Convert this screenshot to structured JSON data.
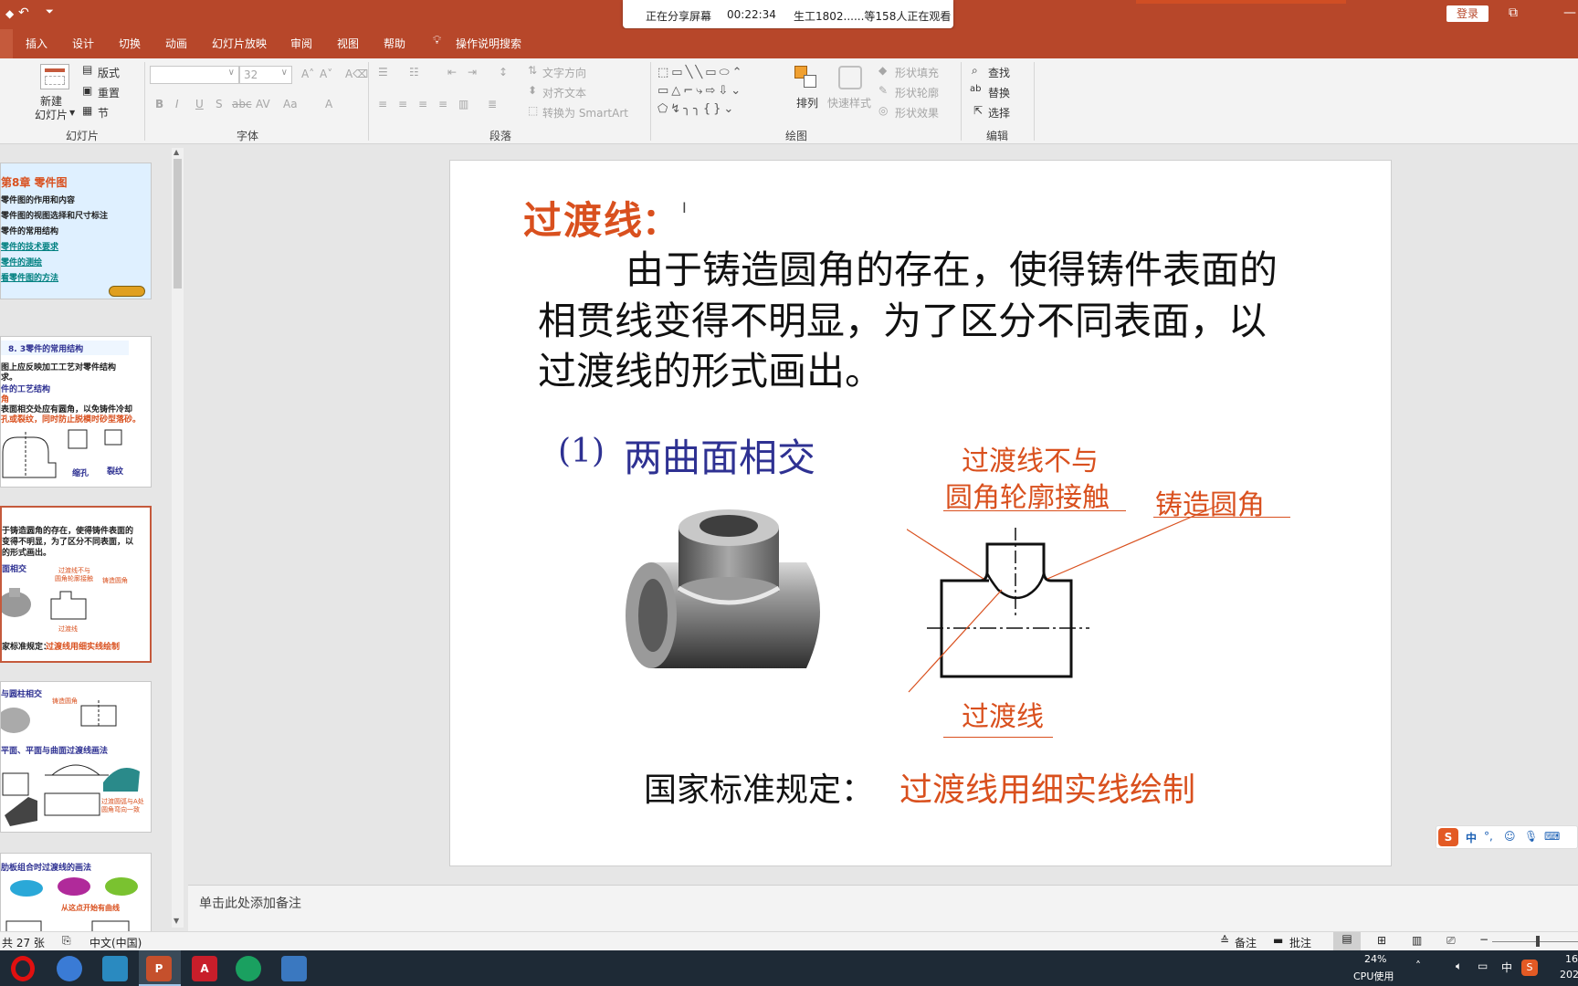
{
  "share_bar": {
    "status": "正在分享屏幕",
    "timer": "00:22:34",
    "viewers": "生工1802......等158人正在观看"
  },
  "title_bar": {
    "login": "登录"
  },
  "tabs": [
    "插入",
    "设计",
    "切换",
    "动画",
    "幻灯片放映",
    "审阅",
    "视图",
    "帮助",
    "操作说明搜索"
  ],
  "ribbon": {
    "slides_group": {
      "new_slide": "新建\n幻灯片",
      "layout": "版式",
      "reset": "重置",
      "section": "节",
      "label": "幻灯片"
    },
    "font_group": {
      "font_size": "32",
      "label": "字体"
    },
    "paragraph_group": {
      "text_direction": "文字方向",
      "align_text": "对齐文本",
      "smartart": "转换为 SmartArt",
      "label": "段落"
    },
    "drawing_group": {
      "arrange": "排列",
      "quick_styles": "快速样式",
      "shape_fill": "形状填充",
      "shape_outline": "形状轮廓",
      "shape_effects": "形状效果",
      "label": "绘图"
    },
    "editing_group": {
      "find": "查找",
      "replace": "替换",
      "select": "选择",
      "label": "编辑"
    }
  },
  "thumbnails": [
    {
      "lines": [
        "第8章 零件图",
        "零件图的作用和内容",
        "零件图的视图选择和尺寸标注",
        "零件的常用结构",
        "零件的技术要求",
        "零件的测绘",
        "看零件图的方法"
      ]
    },
    {
      "lines": [
        "8. 3零件的常用结构",
        "图上应反映加工工艺对零件结构",
        "求。",
        "件的工艺结构",
        "角",
        "表面相交处应有圆角，以免铸件冷却",
        "孔或裂纹，同时防止脱模时砂型落砂。",
        "缩孔",
        "裂纹"
      ]
    },
    {
      "lines": [
        "于铸造圆角的存在，使得铸件表面的",
        "变得不明显，为了区分不同表面，以",
        "的形式画出。",
        "面相交",
        "过渡线不与",
        "圆角轮廓接触",
        "铸造圆角",
        "过渡线",
        "家标准规定：",
        "过渡线用细实线绘制"
      ]
    },
    {
      "lines": [
        "与圆柱相交",
        "铸造圆角",
        "平面、平面与曲面过渡线画法",
        "过渡圆弧与A处",
        "圆角弯向一致"
      ]
    },
    {
      "lines": [
        "肋板组合时过渡线的画法",
        "从这点开始有曲线"
      ]
    }
  ],
  "slide": {
    "title": "过渡线",
    "title_colon": "：",
    "paragraph_lines": [
      "由于铸造圆角的存在，使得铸件表面的",
      "相贯线变得不明显，为了区分不同表面，以",
      "过渡线的形式画出。"
    ],
    "subheading_num": "(1)",
    "subheading": "两曲面相交",
    "callout_1_line1": "过渡线不与",
    "callout_1_line2": "圆角轮廓接触",
    "callout_2": "铸造圆角",
    "callout_3": "过渡线",
    "standard_prefix": "国家标准规定：",
    "standard_rule": "过渡线用细实线绘制"
  },
  "notes_placeholder": "单击此处添加备注",
  "status_bar": {
    "slide_count": "共 27 张",
    "language": "中文(中国)",
    "notes_btn": "备注",
    "comments_btn": "批注"
  },
  "taskbar": {
    "cpu_percent": "24%",
    "cpu_label": "CPU使用",
    "ime_lang": "中",
    "clock_partial": "16",
    "date_partial": "202"
  },
  "colors": {
    "accent": "#b7472a",
    "slide_red": "#d9501e",
    "slide_blue": "#2e3192"
  }
}
